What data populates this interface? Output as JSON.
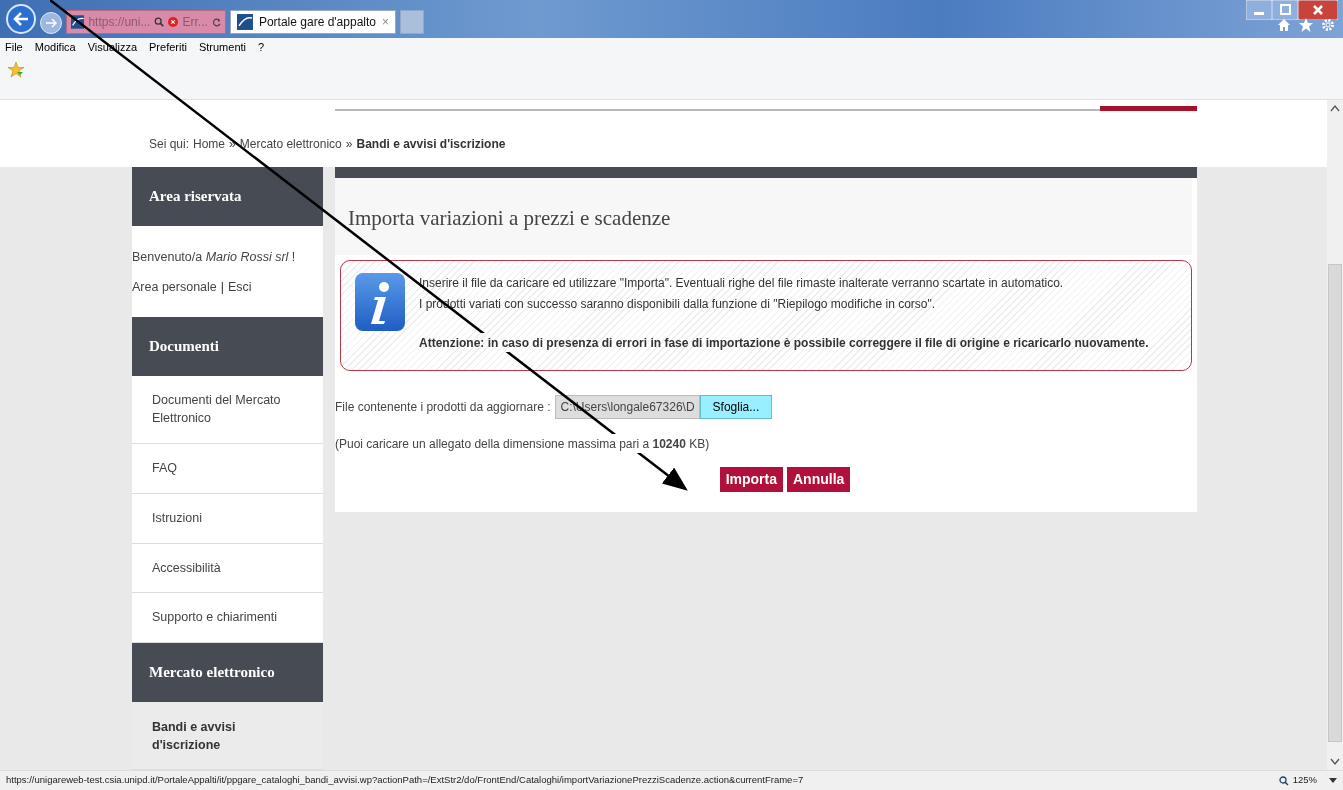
{
  "browser": {
    "address": "https://uni...",
    "error_tab": "Err...",
    "active_tab": "Portale gare d'appalto",
    "close_tab": "×",
    "menu": [
      "File",
      "Modifica",
      "Visualizza",
      "Preferiti",
      "Strumenti",
      "?"
    ]
  },
  "breadcrumb": {
    "prefix": "Sei qui:",
    "separator": "»",
    "items": [
      {
        "label": "Home",
        "current": false
      },
      {
        "label": "Mercato elettronico",
        "current": false
      },
      {
        "label": "Bandi e avvisi d'iscrizione",
        "current": true
      }
    ]
  },
  "sidebar": [
    {
      "kind": "user",
      "title": "Area riservata",
      "welcome": "Benvenuto/a *Mario Rossi srl* !",
      "links": [
        "Area personale",
        "Esci"
      ],
      "link_separator": "|"
    },
    {
      "kind": "menu",
      "title": "Documenti",
      "items": [
        {
          "label": "Documenti del Mercato Elettronico",
          "selected": false
        },
        {
          "label": "FAQ",
          "selected": false
        },
        {
          "label": "Istruzioni",
          "selected": false
        },
        {
          "label": "Accessibilità",
          "selected": false
        },
        {
          "label": "Supporto e chiarimenti",
          "selected": false
        }
      ]
    },
    {
      "kind": "menu",
      "title": "Mercato elettronico",
      "items": [
        {
          "label": "Bandi e avvisi d'iscrizione",
          "selected": true
        }
      ]
    }
  ],
  "main": {
    "title": "Importa variazioni a prezzi e scadenze",
    "info": [
      "Inserire il file da caricare ed utilizzare \"Importa\". Eventuali righe del file rimaste inalterate verranno scartate in automatico.",
      "I prodotti variati con successo saranno disponibili dalla funzione di \"Riepilogo modifiche in corso\"."
    ],
    "warning": "Attenzione: in caso di presenza di errori in fase di importazione è possibile correggere il file di origine e ricaricarlo nuovamente.",
    "file_label": "File contenente i prodotti da aggiornare :",
    "file_value": "C:\\Users\\longale67326\\D",
    "browse": "Sfoglia...",
    "size_note": "(Puoi caricare un allegato della dimensione massima pari a **10240** KB)",
    "buttons": [
      "Importa",
      "Annulla"
    ]
  },
  "status_bar": {
    "url": "https://unigareweb-test.csia.unipd.it/PortaleAppalti/it/ppgare_cataloghi_bandi_avvisi.wp?actionPath=/ExtStr2/do/FrontEnd/Cataloghi/importVariazionePrezziScadenze.action&currentFrame=7",
    "zoom": "125%"
  }
}
